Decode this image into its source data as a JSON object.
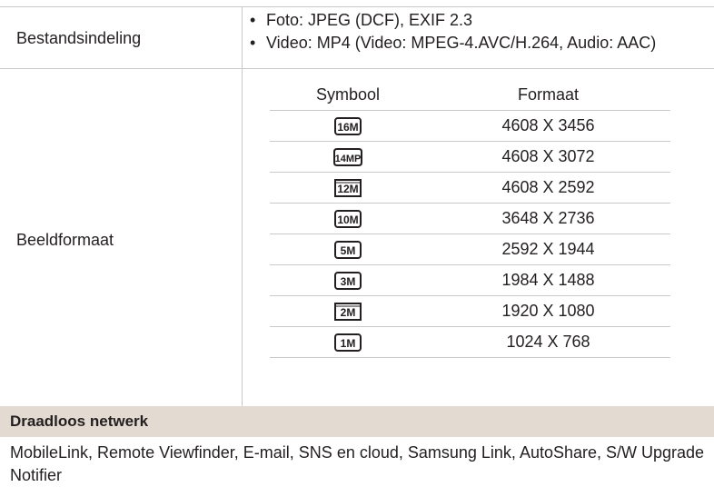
{
  "file_format": {
    "label": "Bestandsindeling",
    "items": [
      "Foto: JPEG (DCF), EXIF 2.3",
      "Video: MP4 (Video: MPEG-4.AVC/H.264, Audio: AAC)"
    ]
  },
  "image_size": {
    "label": "Beeldformaat",
    "headers": {
      "symbol": "Symbool",
      "format": "Formaat"
    },
    "rows": [
      {
        "icon": "16m-icon",
        "format": "4608 X 3456"
      },
      {
        "icon": "14mp-icon",
        "format": "4608 X 3072"
      },
      {
        "icon": "12m-wide-icon",
        "format": "4608 X 2592"
      },
      {
        "icon": "10m-icon",
        "format": "3648 X 2736"
      },
      {
        "icon": "5m-icon",
        "format": "2592 X 1944"
      },
      {
        "icon": "3m-icon",
        "format": "1984 X 1488"
      },
      {
        "icon": "2m-wide-icon",
        "format": "1920 X 1080"
      },
      {
        "icon": "1m-icon",
        "format": "1024 X 768"
      }
    ]
  },
  "wireless": {
    "header": "Draadloos netwerk",
    "description": "MobileLink, Remote Viewfinder, E-mail, SNS en cloud, Samsung Link, AutoShare, S/W Upgrade Notifier"
  },
  "colors": {
    "section_header_bg": "#e3dbd1",
    "rule": "#c9c9c9",
    "text": "#231f20"
  }
}
